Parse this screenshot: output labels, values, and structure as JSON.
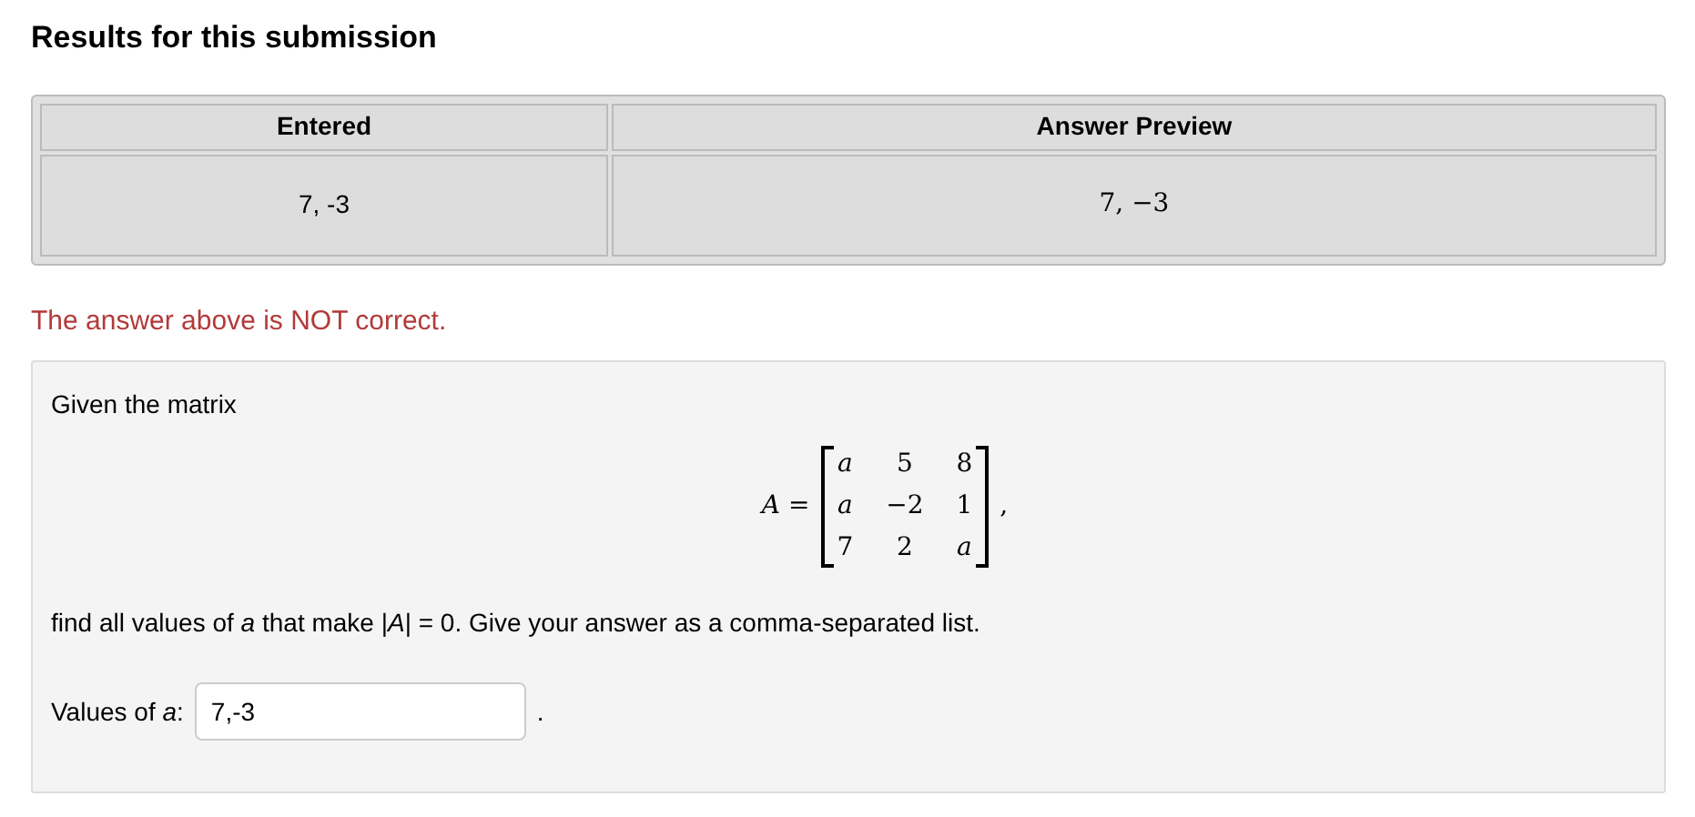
{
  "heading": "Results for this submission",
  "table": {
    "columns": [
      "Entered",
      "Answer Preview"
    ],
    "rows": [
      {
        "entered": "7, -3",
        "preview": "7, −3"
      }
    ]
  },
  "feedback": "The answer above is NOT correct.",
  "problem": {
    "intro": "Given the matrix",
    "matrix_label": "*A* =",
    "matrix": [
      [
        {
          "text": "a",
          "kind": "var"
        },
        {
          "text": "5",
          "kind": "num"
        },
        {
          "text": "8",
          "kind": "num"
        }
      ],
      [
        {
          "text": "a",
          "kind": "var"
        },
        {
          "text": "−2",
          "kind": "num"
        },
        {
          "text": "1",
          "kind": "num"
        }
      ],
      [
        {
          "text": "7",
          "kind": "num"
        },
        {
          "text": "2",
          "kind": "num"
        },
        {
          "text": "a",
          "kind": "var"
        }
      ]
    ],
    "matrix_suffix": ",",
    "question": "find all values of *a* that make |*A*| = 0. Give your answer as a comma-separated list.",
    "answer_label": "Values of *a*:",
    "answer_value": "7,-3",
    "answer_suffix": "."
  }
}
